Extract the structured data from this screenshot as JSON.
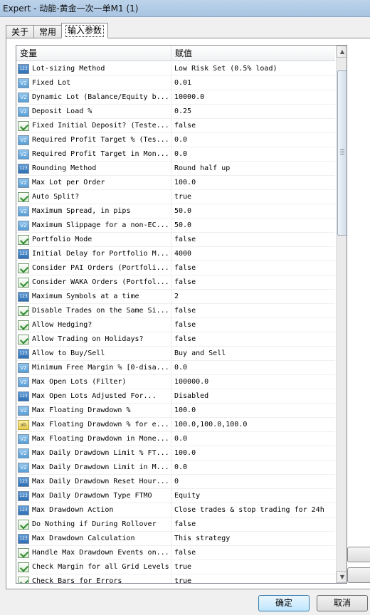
{
  "window": {
    "title": "Expert - 动能-黄金一次一单M1 (1)"
  },
  "tabs": [
    {
      "label": "关于"
    },
    {
      "label": "常用"
    },
    {
      "label": "输入参数"
    }
  ],
  "grid": {
    "col_variable": "变量",
    "col_value": "赋值",
    "rows": [
      {
        "icon": "int-icon",
        "name": "Lot-sizing Method",
        "value": "Low Risk Set (0.5% load)"
      },
      {
        "icon": "double-icon",
        "name": "Fixed Lot",
        "value": "0.01"
      },
      {
        "icon": "double-icon",
        "name": "Dynamic Lot (Balance/Equity b...",
        "value": "10000.0"
      },
      {
        "icon": "double-icon",
        "name": "Deposit Load %",
        "value": "0.25"
      },
      {
        "icon": "bool-icon",
        "name": "Fixed Initial Deposit? (Teste...",
        "value": "false"
      },
      {
        "icon": "double-icon",
        "name": "Required Profit Target % (Tes...",
        "value": "0.0"
      },
      {
        "icon": "double-icon",
        "name": "Required Profit Target in Mon...",
        "value": "0.0"
      },
      {
        "icon": "int-icon",
        "name": "Rounding Method",
        "value": "Round half up"
      },
      {
        "icon": "double-icon",
        "name": "Max Lot per Order",
        "value": "100.0"
      },
      {
        "icon": "bool-icon",
        "name": "Auto Split?",
        "value": "true"
      },
      {
        "icon": "double-icon",
        "name": "Maximum Spread, in pips",
        "value": "50.0"
      },
      {
        "icon": "double-icon",
        "name": "Maximum Slippage for a non-EC...",
        "value": "50.0"
      },
      {
        "icon": "bool-icon",
        "name": "Portfolio Mode",
        "value": "false"
      },
      {
        "icon": "int-icon",
        "name": "Initial Delay for Portfolio M...",
        "value": "4000"
      },
      {
        "icon": "bool-icon",
        "name": "Consider PAI Orders (Portfoli...",
        "value": "false"
      },
      {
        "icon": "bool-icon",
        "name": "Consider WAKA Orders (Portfol...",
        "value": "false"
      },
      {
        "icon": "int-icon",
        "name": "Maximum Symbols at a time",
        "value": "2"
      },
      {
        "icon": "bool-icon",
        "name": "Disable Trades on the Same Si...",
        "value": "false"
      },
      {
        "icon": "bool-icon",
        "name": "Allow Hedging?",
        "value": "false"
      },
      {
        "icon": "bool-icon",
        "name": "Allow Trading on Holidays?",
        "value": "false"
      },
      {
        "icon": "int-icon",
        "name": "Allow to Buy/Sell",
        "value": "Buy and Sell"
      },
      {
        "icon": "double-icon",
        "name": "Minimum Free Margin % [0-disa...",
        "value": "0.0"
      },
      {
        "icon": "double-icon",
        "name": "Max Open Lots (Filter)",
        "value": "100000.0"
      },
      {
        "icon": "int-icon",
        "name": "Max Open Lots Adjusted For...",
        "value": "Disabled"
      },
      {
        "icon": "double-icon",
        "name": "Max Floating Drawdown %",
        "value": "100.0"
      },
      {
        "icon": "string-icon",
        "name": "Max Floating Drawdown % for e...",
        "value": "100.0,100.0,100.0"
      },
      {
        "icon": "double-icon",
        "name": "Max Floating Drawdown in Mone...",
        "value": "0.0"
      },
      {
        "icon": "double-icon",
        "name": "Max Daily Drawdown Limit % FT...",
        "value": "100.0"
      },
      {
        "icon": "double-icon",
        "name": "Max Daily Drawdown Limit in M...",
        "value": "0.0"
      },
      {
        "icon": "int-icon",
        "name": "Max Daily Drawdown Reset Hour...",
        "value": "0"
      },
      {
        "icon": "int-icon",
        "name": "Max Daily Drawdown Type FTMO",
        "value": "Equity"
      },
      {
        "icon": "int-icon",
        "name": "Max Drawdown Action",
        "value": "Close trades & stop trading for 24h"
      },
      {
        "icon": "bool-icon",
        "name": "Do Nothing if During Rollover",
        "value": "false"
      },
      {
        "icon": "int-icon",
        "name": "Max Drawdown Calculation",
        "value": "This strategy"
      },
      {
        "icon": "bool-icon",
        "name": "Handle Max Drawdown Events on...",
        "value": "false"
      },
      {
        "icon": "bool-icon",
        "name": "Check Margin for all Grid Levels",
        "value": "true"
      },
      {
        "icon": "bool-icon",
        "name": "Check Bars for Errors",
        "value": "true"
      }
    ]
  },
  "buttons": {
    "ok": "确定",
    "cancel": "取消"
  }
}
